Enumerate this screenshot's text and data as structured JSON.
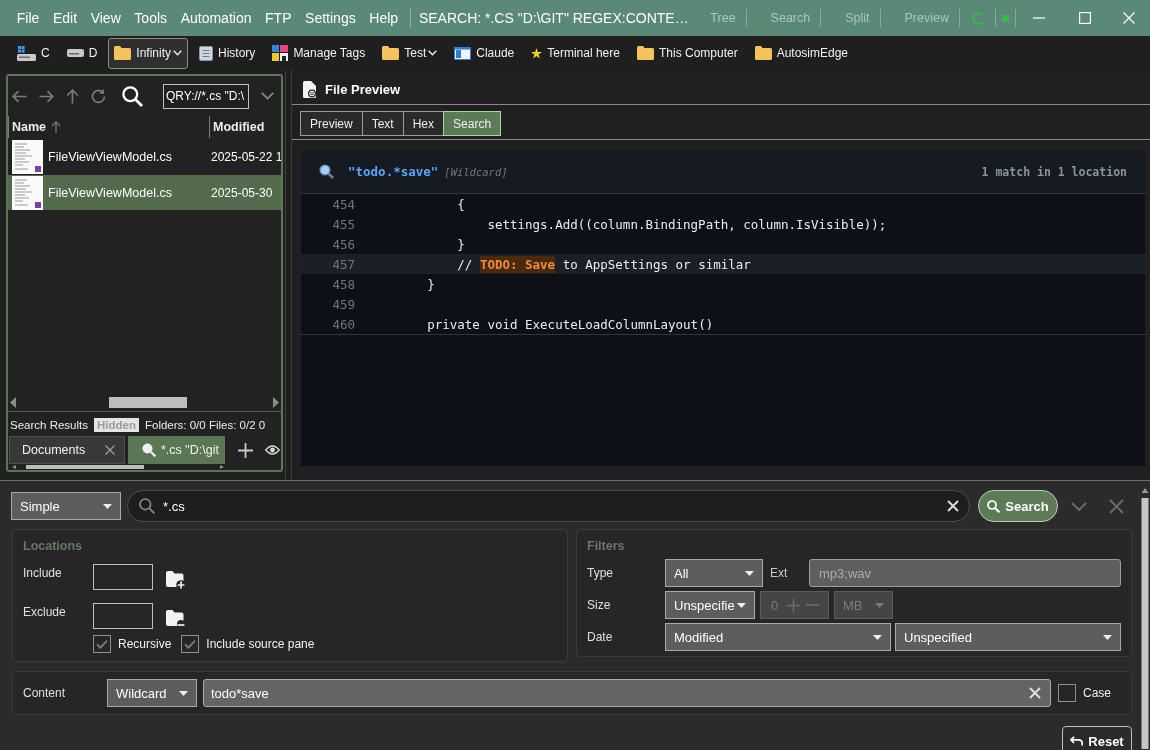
{
  "window": {
    "menu": [
      "File",
      "Edit",
      "View",
      "Tools",
      "Automation",
      "FTP",
      "Settings",
      "Help"
    ],
    "title": "SEARCH: *.CS \"D:\\GIT\" REGEX:CONTE…",
    "view_buttons": [
      "Tree",
      "Search",
      "Split",
      "Preview"
    ]
  },
  "toolbar": [
    {
      "kind": "system-drive",
      "label": "C",
      "selected": false,
      "dropdown": false
    },
    {
      "kind": "drive",
      "label": "D",
      "selected": false,
      "dropdown": false
    },
    {
      "kind": "folder",
      "label": "Infinity",
      "selected": true,
      "dropdown": true
    },
    {
      "kind": "history",
      "label": "History",
      "selected": false,
      "dropdown": false
    },
    {
      "kind": "tags",
      "label": "Manage Tags",
      "selected": false,
      "dropdown": false
    },
    {
      "kind": "folder",
      "label": "Test",
      "selected": false,
      "dropdown": true
    },
    {
      "kind": "window",
      "label": "Claude",
      "selected": false,
      "dropdown": false
    },
    {
      "kind": "star",
      "label": "Terminal here",
      "selected": false,
      "dropdown": false
    },
    {
      "kind": "folder",
      "label": "This Computer",
      "selected": false,
      "dropdown": false
    },
    {
      "kind": "folder",
      "label": "AutosimEdge",
      "selected": false,
      "dropdown": false
    }
  ],
  "file_pane": {
    "address": "QRY://*.cs \"D:\\",
    "columns": [
      {
        "label": "Name",
        "sorted": true
      },
      {
        "label": "Modified",
        "sorted": false
      }
    ],
    "rows": [
      {
        "name": "FileViewViewModel.cs",
        "modified": "2025-05-22 1",
        "selected": false
      },
      {
        "name": "FileViewViewModel.cs",
        "modified": "2025-05-30",
        "selected": true
      }
    ],
    "status": {
      "label": "Search Results",
      "badge": "Hidden",
      "counts": "Folders: 0/0 Files: 0/2 0"
    },
    "tabs": [
      {
        "label": "Documents",
        "kind": "plain",
        "selected": false,
        "closable": true
      },
      {
        "label": "*.cs \"D:\\git",
        "kind": "search",
        "selected": true,
        "closable": false
      }
    ]
  },
  "preview": {
    "title": "File Preview",
    "tabs": [
      {
        "label": "Preview",
        "selected": false
      },
      {
        "label": "Text",
        "selected": false
      },
      {
        "label": "Hex",
        "selected": false
      },
      {
        "label": "Search",
        "selected": true
      }
    ],
    "search": {
      "query": "\"todo.*save\"",
      "mode": "[Wildcard]",
      "summary": "1 match in 1 location",
      "lines": [
        {
          "number": "454",
          "current": false,
          "segments": [
            {
              "text": "            {",
              "match": false
            }
          ]
        },
        {
          "number": "455",
          "current": false,
          "segments": [
            {
              "text": "                settings.Add((column.BindingPath, column.IsVisible));",
              "match": false
            }
          ]
        },
        {
          "number": "456",
          "current": false,
          "segments": [
            {
              "text": "            }",
              "match": false
            }
          ]
        },
        {
          "number": "457",
          "current": true,
          "segments": [
            {
              "text": "            // ",
              "match": false
            },
            {
              "text": "TODO: Save",
              "match": true
            },
            {
              "text": " to AppSettings or similar",
              "match": false
            }
          ]
        },
        {
          "number": "458",
          "current": false,
          "segments": [
            {
              "text": "        }",
              "match": false
            }
          ]
        },
        {
          "number": "459",
          "current": false
        },
        {
          "number": "460",
          "current": false,
          "segments": [
            {
              "text": "        private void ExecuteLoadColumnLayout()",
              "match": false
            }
          ]
        }
      ]
    }
  },
  "search_panel": {
    "mode": "Simple",
    "query": "*.cs",
    "search_button": "Search",
    "locations": {
      "title": "Locations",
      "include": "Include",
      "exclude": "Exclude",
      "options": [
        {
          "label": "Recursive",
          "checked": true
        },
        {
          "label": "Include source pane",
          "checked": true
        }
      ]
    },
    "filters": {
      "title": "Filters",
      "type": {
        "label": "Type",
        "value": "All"
      },
      "ext": {
        "label": "Ext",
        "placeholder": "mp3;wav"
      },
      "size": {
        "label": "Size",
        "value": "Unspecifie",
        "amount": "0",
        "unit": "MB",
        "disabled": true
      },
      "date": {
        "label": "Date",
        "field": "Modified",
        "range": "Unspecified"
      }
    },
    "content": {
      "label": "Content",
      "mode": "Wildcard",
      "value": "todo*save",
      "case": {
        "label": "Case",
        "checked": false
      }
    },
    "reset_button": "Reset"
  }
}
